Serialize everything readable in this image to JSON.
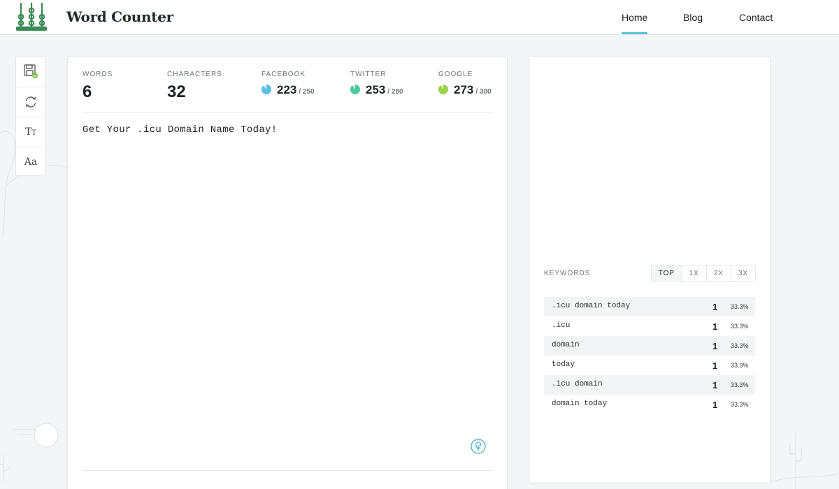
{
  "header": {
    "brand": "Word Counter",
    "nav": [
      {
        "label": "Home",
        "active": true
      },
      {
        "label": "Blog",
        "active": false
      },
      {
        "label": "Contact",
        "active": false
      }
    ]
  },
  "toolbar": {
    "items": [
      {
        "name": "save-icon"
      },
      {
        "name": "refresh-icon"
      },
      {
        "name": "text-size-icon",
        "label": "TT"
      },
      {
        "name": "font-icon",
        "label": "Aa"
      }
    ]
  },
  "stats": {
    "words_label": "WORDS",
    "words_value": "6",
    "characters_label": "CHARACTERS",
    "characters_value": "32",
    "facebook_label": "FACEBOOK",
    "facebook_value": "223",
    "facebook_limit": "/ 250",
    "twitter_label": "TWITTER",
    "twitter_value": "253",
    "twitter_limit": "/ 280",
    "google_label": "GOOGLE",
    "google_value": "273",
    "google_limit": "/ 300"
  },
  "colors": {
    "facebook": "#5bc2e0",
    "twitter": "#4cc99a",
    "google": "#9bd14b",
    "accent": "#5cc6d6"
  },
  "editor": {
    "text": "Get Your .icu Domain Name Today!"
  },
  "keywords": {
    "label": "KEYWORDS",
    "tabs": [
      "TOP",
      "1X",
      "2X",
      "3X"
    ],
    "rows": [
      {
        "keyword": ".icu domain today",
        "count": "1",
        "percent": "33.3%"
      },
      {
        "keyword": ".icu",
        "count": "1",
        "percent": "33.3%"
      },
      {
        "keyword": "domain",
        "count": "1",
        "percent": "33.3%"
      },
      {
        "keyword": "today",
        "count": "1",
        "percent": "33.3%"
      },
      {
        "keyword": ".icu domain",
        "count": "1",
        "percent": "33.3%"
      },
      {
        "keyword": "domain today",
        "count": "1",
        "percent": "33.3%"
      }
    ]
  }
}
